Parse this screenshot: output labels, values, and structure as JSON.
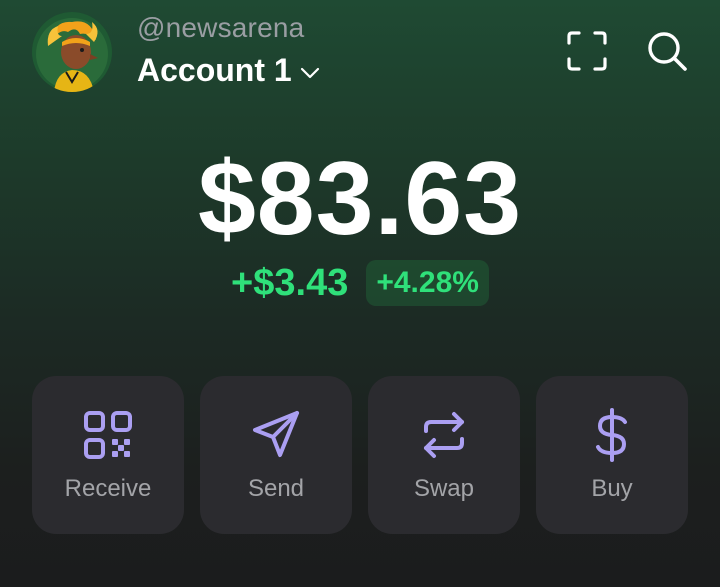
{
  "profile": {
    "handle": "@newsarena",
    "account_name": "Account 1"
  },
  "portfolio": {
    "balance": "$83.63",
    "change_amount": "+$3.43",
    "change_percent": "+4.28%"
  },
  "actions": [
    {
      "label": "Receive",
      "icon": "qr-code-icon"
    },
    {
      "label": "Send",
      "icon": "send-icon"
    },
    {
      "label": "Swap",
      "icon": "swap-icon"
    },
    {
      "label": "Buy",
      "icon": "dollar-icon"
    }
  ],
  "colors": {
    "accent_purple": "#ab9ff2",
    "positive_green": "#2fe07a",
    "card_bg": "#2b2b2f"
  }
}
